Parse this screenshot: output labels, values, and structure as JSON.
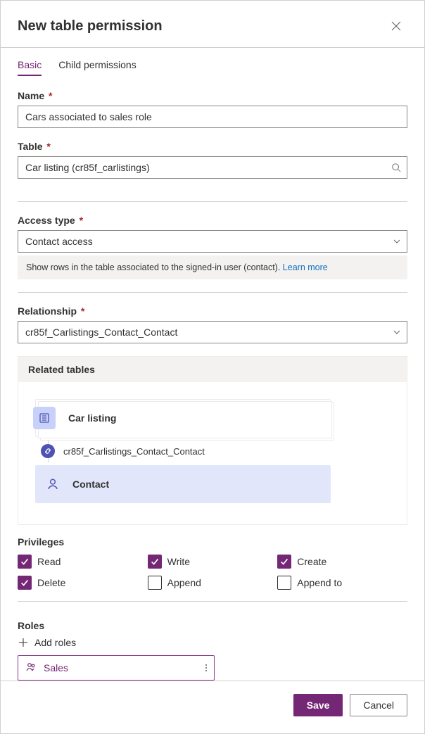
{
  "header": {
    "title": "New table permission"
  },
  "tabs": {
    "basic": "Basic",
    "child": "Child permissions"
  },
  "fields": {
    "name_label": "Name",
    "name_value": "Cars associated to sales role",
    "table_label": "Table",
    "table_value": "Car listing (cr85f_carlistings)",
    "access_label": "Access type",
    "access_value": "Contact access",
    "access_info": "Show rows in the table associated to the signed-in user (contact).",
    "access_learn": "Learn more",
    "relationship_label": "Relationship",
    "relationship_value": "cr85f_Carlistings_Contact_Contact"
  },
  "related": {
    "header": "Related tables",
    "card1": "Car listing",
    "link": "cr85f_Carlistings_Contact_Contact",
    "card2": "Contact"
  },
  "privileges": {
    "header": "Privileges",
    "items": [
      {
        "label": "Read",
        "checked": true
      },
      {
        "label": "Write",
        "checked": true
      },
      {
        "label": "Create",
        "checked": true
      },
      {
        "label": "Delete",
        "checked": true
      },
      {
        "label": "Append",
        "checked": false
      },
      {
        "label": "Append to",
        "checked": false
      }
    ]
  },
  "roles": {
    "header": "Roles",
    "add": "Add roles",
    "chip": "Sales"
  },
  "footer": {
    "save": "Save",
    "cancel": "Cancel"
  }
}
